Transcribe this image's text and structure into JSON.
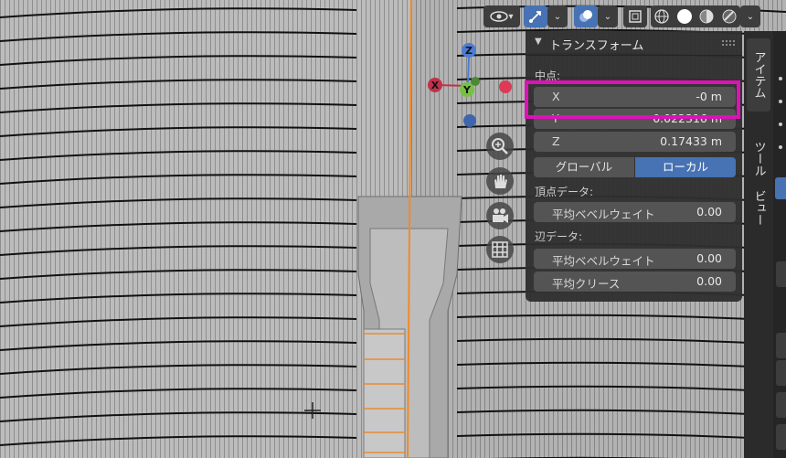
{
  "header": {
    "icons": [
      "eye-icon",
      "gizmo-icon",
      "overlay-icon",
      "xray-icon",
      "wireframe-shading-icon",
      "solid-shading-icon",
      "material-shading-icon",
      "rendered-shading-icon",
      "chevron-down-icon"
    ]
  },
  "panel": {
    "title": "トランスフォーム",
    "median_label": "中点:",
    "x_label": "X",
    "x_value": "-0 m",
    "y_label": "Y",
    "y_value": "0.022316 m",
    "z_label": "Z",
    "z_value": "0.17433 m",
    "global_label": "グローバル",
    "local_label": "ローカル",
    "vertex_data_label": "頂点データ:",
    "vertex_bevel_label": "平均ベベルウェイト",
    "vertex_bevel_value": "0.00",
    "edge_data_label": "辺データ:",
    "edge_bevel_label": "平均ベベルウェイト",
    "edge_bevel_value": "0.00",
    "edge_crease_label": "平均クリース",
    "edge_crease_value": "0.00"
  },
  "tabs": {
    "item": "アイテム",
    "tool": "ツール",
    "view": "ビュー"
  },
  "gizmo": {
    "x": "X",
    "y": "Y",
    "z": "Z"
  },
  "colors": {
    "highlight": "#e010b8",
    "accent": "#4772b3",
    "mesh": "#b9b9b9",
    "edge_selected": "#f08a2a"
  }
}
